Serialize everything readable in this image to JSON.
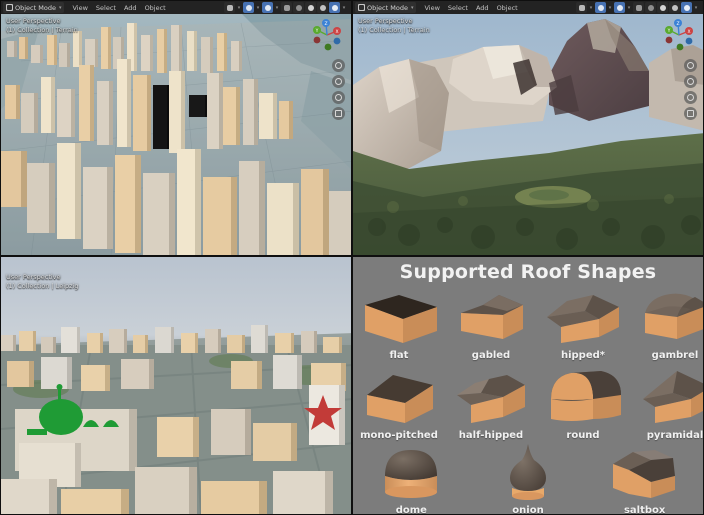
{
  "app": {
    "name": "Blender",
    "layout": "2x2 quad 3D viewport"
  },
  "panes": [
    {
      "id": "nyc",
      "header": {
        "mode": "Object Mode",
        "mode_icon": "object-mode-cube-icon",
        "dropdown_icon": "chevron-down-icon",
        "menus": [
          "View",
          "Select",
          "Add",
          "Object"
        ],
        "right_icons": [
          "snap-magnet-icon",
          "chevron-down-icon",
          "proportional-editing-icon",
          "chevron-down-icon",
          "transform-orientation-icon",
          "chevron-down-icon",
          "toggle-xray-icon",
          "shading-wireframe-icon",
          "shading-solid-icon",
          "shading-material-icon",
          "shading-rendered-icon",
          "chevron-down-icon"
        ]
      },
      "overlay": {
        "line1": "User Perspective",
        "line2": "(1) Collection | Terrain"
      },
      "gizmo": {
        "axes": [
          {
            "label": "X",
            "color": "#cc4444"
          },
          {
            "label": "Y",
            "color": "#5aaa2e"
          },
          {
            "label": "Z",
            "color": "#3b82d6"
          }
        ]
      },
      "tools": [
        "zoom-icon",
        "move-hand-icon",
        "camera-icon",
        "grid-icon"
      ]
    },
    {
      "id": "terrain",
      "header": {
        "mode": "Object Mode",
        "mode_icon": "object-mode-cube-icon",
        "dropdown_icon": "chevron-down-icon",
        "menus": [
          "View",
          "Select",
          "Add",
          "Object"
        ],
        "right_icons": [
          "snap-magnet-icon",
          "chevron-down-icon",
          "proportional-editing-icon",
          "chevron-down-icon",
          "transform-orientation-icon",
          "chevron-down-icon",
          "toggle-xray-icon",
          "shading-wireframe-icon",
          "shading-solid-icon",
          "shading-material-icon",
          "shading-rendered-icon",
          "chevron-down-icon"
        ]
      },
      "overlay": {
        "line1": "User Perspective",
        "line2": "(1) Collection | Terrain"
      },
      "gizmo": {
        "axes": [
          {
            "label": "X",
            "color": "#cc4444"
          },
          {
            "label": "Y",
            "color": "#5aaa2e"
          },
          {
            "label": "Z",
            "color": "#3b82d6"
          }
        ]
      },
      "tools": [
        "zoom-icon",
        "move-hand-icon",
        "camera-icon",
        "grid-icon"
      ]
    },
    {
      "id": "leipzig",
      "overlay": {
        "line1": "User Perspective",
        "line2": "(1) Collection | Leipzig"
      }
    }
  ],
  "roof_panel": {
    "title": "Supported Roof Shapes",
    "background_color": "#7c7c7c",
    "wall_color": "#e6a469",
    "roof_color": "#5b5148",
    "rows": [
      [
        {
          "label": "flat",
          "shape": "flat"
        },
        {
          "label": "gabled",
          "shape": "gabled"
        },
        {
          "label": "hipped*",
          "shape": "hipped"
        },
        {
          "label": "gambrel",
          "shape": "gambrel"
        }
      ],
      [
        {
          "label": "mono-pitched",
          "shape": "mono-pitched"
        },
        {
          "label": "half-hipped",
          "shape": "half-hipped"
        },
        {
          "label": "round",
          "shape": "round"
        },
        {
          "label": "pyramidal",
          "shape": "pyramidal"
        }
      ],
      [
        {
          "label": "dome",
          "shape": "dome"
        },
        {
          "label": "onion",
          "shape": "onion"
        },
        {
          "label": "saltbox",
          "shape": "saltbox"
        }
      ]
    ]
  }
}
